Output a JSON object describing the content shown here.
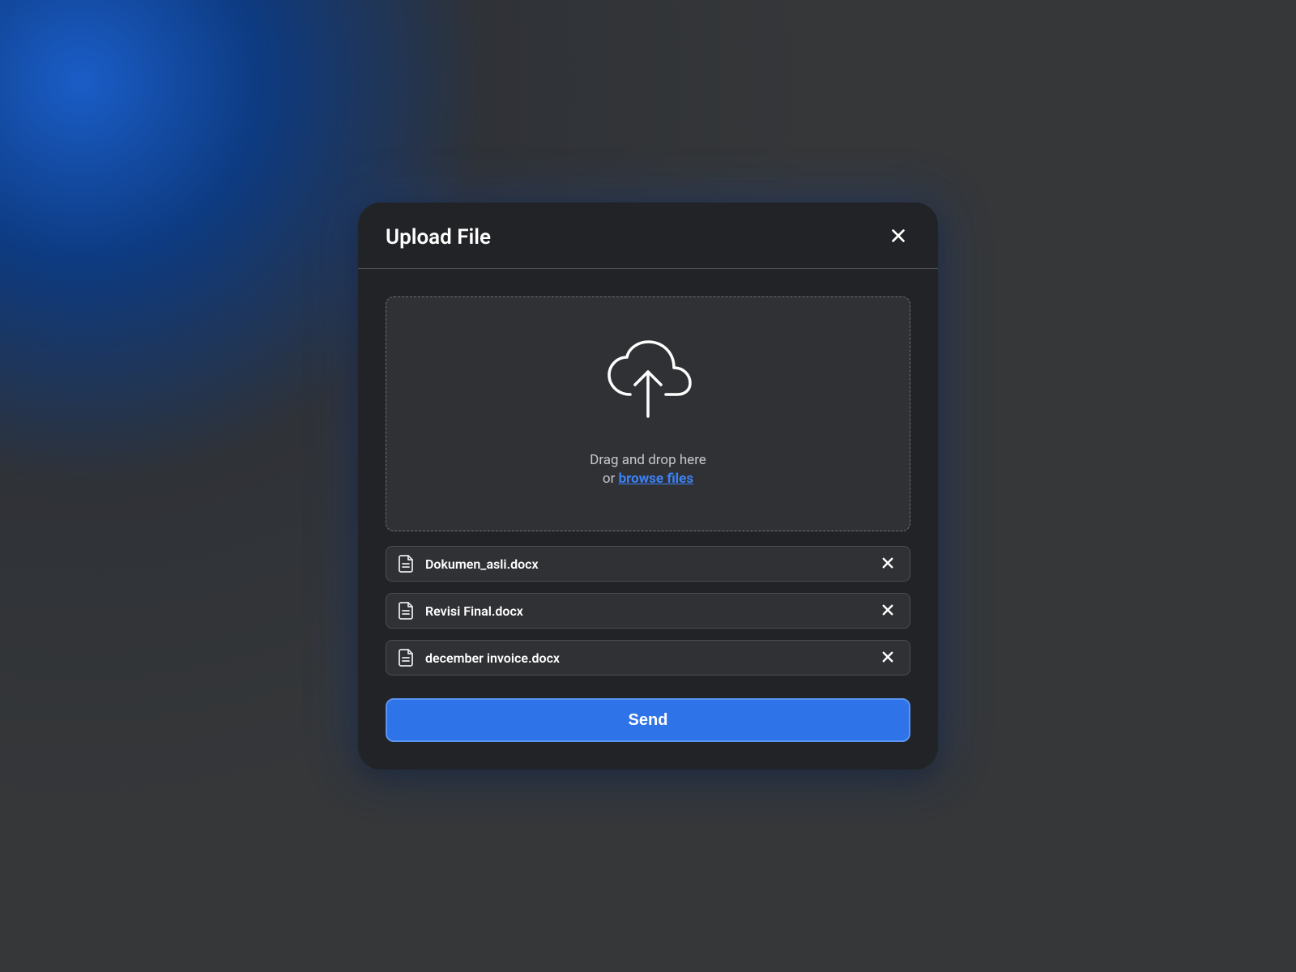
{
  "modal": {
    "title": "Upload File",
    "dropzone": {
      "drag_text": "Drag and drop here",
      "or_text": "or ",
      "browse_text": "browse files"
    },
    "files": [
      {
        "name": "Dokumen_asli.docx"
      },
      {
        "name": "Revisi Final.docx"
      },
      {
        "name": "december invoice.docx"
      }
    ],
    "send_label": "Send"
  }
}
